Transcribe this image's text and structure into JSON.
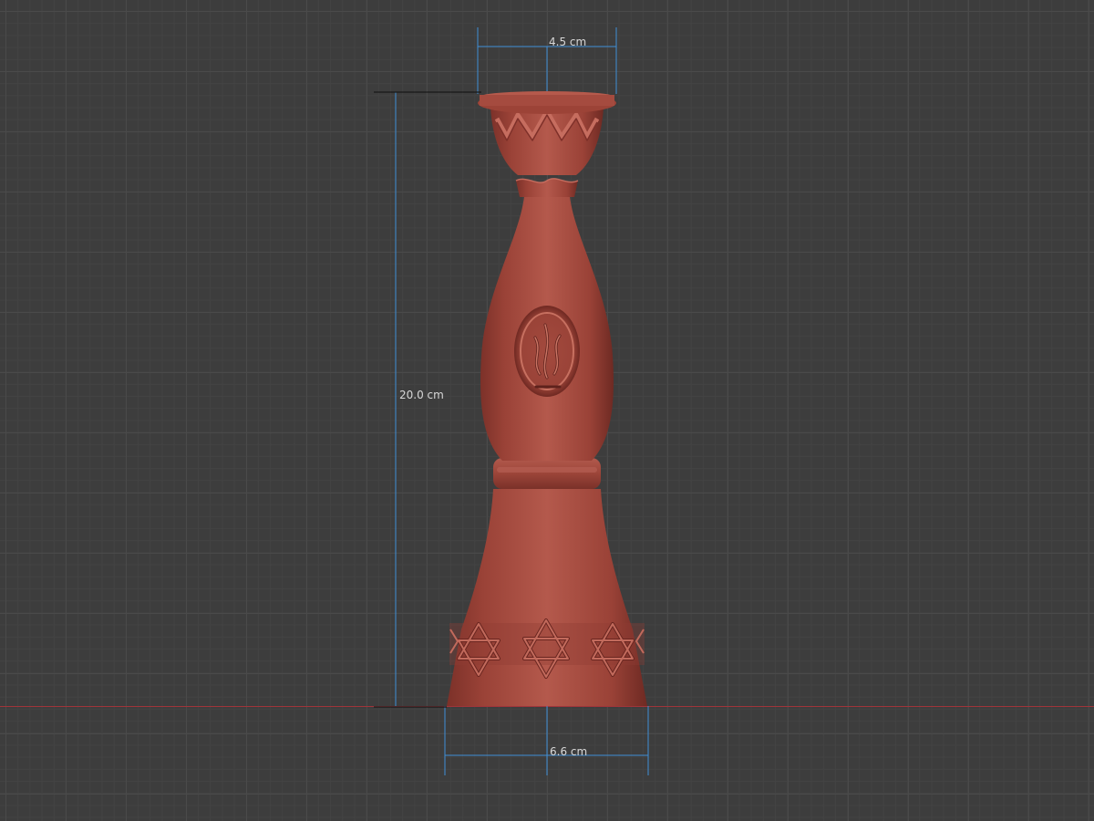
{
  "viewport": {
    "background_color": "#3d3d3d",
    "grid_color": "#4a4a4a",
    "ground_axis_color": "#a0343a"
  },
  "model": {
    "name_icon": "candlestick-model-icon",
    "material_color": "#a04a40"
  },
  "dimensions": {
    "top_width": "4.5 cm",
    "height": "20.0 cm",
    "base_width": "6.6 cm",
    "line_color": "#3f8fd6"
  }
}
